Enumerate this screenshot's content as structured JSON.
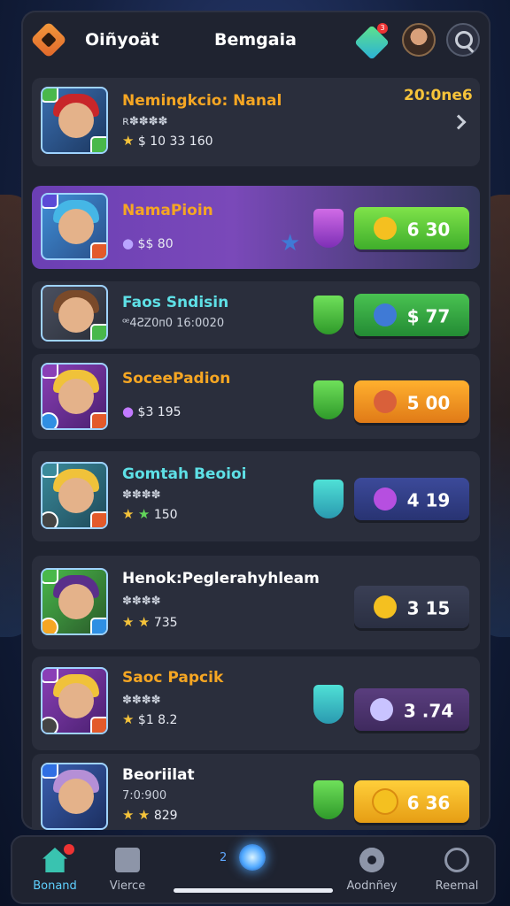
{
  "header": {
    "app_title": "Oiñyoät",
    "center_title": "Bemgaia",
    "gem_badge": "3"
  },
  "rows": [
    {
      "title": "Nemingkcio: Nanal",
      "title_color": "#f5a623",
      "sub": "ʀ✽✽✽✽",
      "meta": "$ 10  33 160",
      "extra": "20:0ne6"
    },
    {
      "title": "NamaPioin",
      "title_color": "#f5a623",
      "meta": "$$ 80",
      "price": "6 30"
    },
    {
      "title": "Faos Sndisin",
      "title_color": "#5ee0e6",
      "sub": "ꟹ4ƧᏃ0ᴨ0 16:0020",
      "price": "$ 77"
    },
    {
      "title": "SoceePadion",
      "title_color": "#f5a623",
      "meta": "$3 195",
      "price": "5 00"
    },
    {
      "title": "Gomtah Beoioi",
      "title_color": "#5ee0e6",
      "sub": "✽✽✽✽",
      "meta": "150",
      "price": "4 19"
    },
    {
      "title": "Henok:Peglerahyhleam",
      "title_color": "#ffffff",
      "sub": "✽✽✽✽",
      "meta": "735",
      "price": "3 15"
    },
    {
      "title": "Saoc Papcik",
      "title_color": "#f5a623",
      "sub": "✽✽✽✽",
      "meta": "$1 8.2",
      "price": "3 .74"
    },
    {
      "title": "Beoriilat",
      "title_color": "#ffffff",
      "sub": "7:0:900",
      "meta": "829",
      "price": "6 36"
    }
  ],
  "nav": {
    "home": "Bonand",
    "messages": "Vierce",
    "center": "2",
    "settings": "Aodnñey",
    "search": "Reemal"
  },
  "colors": {
    "accent_orange": "#f5a623",
    "accent_cyan": "#5ee0e6",
    "panel_bg": "#1f2330",
    "row_bg": "#2a2e3c",
    "featured_purple": "#7a49b9"
  }
}
